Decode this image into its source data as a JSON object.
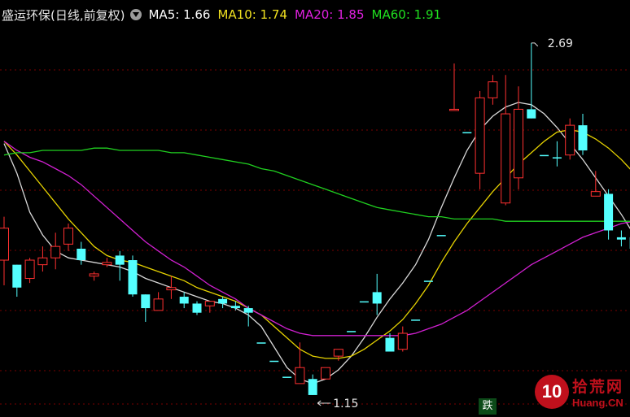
{
  "header": {
    "title": "盛运环保(日线,前复权)",
    "ma": [
      {
        "label": "MA5: ",
        "value": "1.66",
        "color": "#ffffff"
      },
      {
        "label": "MA10: ",
        "value": "1.74",
        "color": "#f0e020"
      },
      {
        "label": "MA20: ",
        "value": "1.85",
        "color": "#e020e0"
      },
      {
        "label": "MA60: ",
        "value": "1.91",
        "color": "#20e020"
      }
    ]
  },
  "annotations": {
    "high_label": "2.69",
    "low_label": "1.15",
    "fall_badge": "跌"
  },
  "watermark": {
    "number": "10",
    "cn": "拾荒网",
    "en": "Huang.CN"
  },
  "colors": {
    "up": "#ff3030",
    "down": "#54ffff",
    "grid": "#7a0000"
  },
  "chart_data": {
    "type": "candlestick",
    "ylim": [
      1.1,
      2.75
    ],
    "candles": [
      [
        1.88,
        1.74,
        1.93,
        1.63,
        "up"
      ],
      [
        1.72,
        1.62,
        1.72,
        1.58,
        "down"
      ],
      [
        1.66,
        1.74,
        1.75,
        1.64,
        "up"
      ],
      [
        1.72,
        1.75,
        1.8,
        1.69,
        "up"
      ],
      [
        1.75,
        1.8,
        1.86,
        1.7,
        "up"
      ],
      [
        1.81,
        1.88,
        1.9,
        1.78,
        "up"
      ],
      [
        1.79,
        1.74,
        1.82,
        1.72,
        "down"
      ],
      [
        1.68,
        1.67,
        1.69,
        1.65,
        "up"
      ],
      [
        1.72,
        1.73,
        1.75,
        1.71,
        "up"
      ],
      [
        1.76,
        1.72,
        1.78,
        1.65,
        "down"
      ],
      [
        1.74,
        1.59,
        1.76,
        1.58,
        "down"
      ],
      [
        1.59,
        1.53,
        1.59,
        1.47,
        "down"
      ],
      [
        1.52,
        1.57,
        1.6,
        1.52,
        "up"
      ],
      [
        1.61,
        1.62,
        1.67,
        1.57,
        "up"
      ],
      [
        1.58,
        1.55,
        1.6,
        1.53,
        "down"
      ],
      [
        1.55,
        1.51,
        1.56,
        1.5,
        "down"
      ],
      [
        1.54,
        1.56,
        1.56,
        1.51,
        "up"
      ],
      [
        1.57,
        1.55,
        1.58,
        1.53,
        "down"
      ],
      [
        1.54,
        1.53,
        1.56,
        1.52,
        "down"
      ],
      [
        1.53,
        1.51,
        1.54,
        1.45,
        "down"
      ],
      [
        1.38,
        1.38,
        1.38,
        1.38,
        "down"
      ],
      [
        1.3,
        1.3,
        1.3,
        1.3,
        "down"
      ],
      [
        1.23,
        1.23,
        1.23,
        1.23,
        "down"
      ],
      [
        1.2,
        1.27,
        1.38,
        1.2,
        "up"
      ],
      [
        1.22,
        1.15,
        1.24,
        1.15,
        "down"
      ],
      [
        1.22,
        1.27,
        1.27,
        1.22,
        "up"
      ],
      [
        1.32,
        1.35,
        1.35,
        1.3,
        "up"
      ],
      [
        1.43,
        1.43,
        1.43,
        1.43,
        "down"
      ],
      [
        1.56,
        1.56,
        1.56,
        1.56,
        "down"
      ],
      [
        1.6,
        1.55,
        1.68,
        1.5,
        "down"
      ],
      [
        1.4,
        1.34,
        1.42,
        1.34,
        "down"
      ],
      [
        1.35,
        1.42,
        1.45,
        1.34,
        "up"
      ],
      [
        1.48,
        1.48,
        1.48,
        1.48,
        "down"
      ],
      [
        1.65,
        1.65,
        1.65,
        1.65,
        "down"
      ],
      [
        1.85,
        1.85,
        1.85,
        1.85,
        "down"
      ],
      [
        2.4,
        2.4,
        2.6,
        2.4,
        "up"
      ],
      [
        2.3,
        2.3,
        2.3,
        2.3,
        "down"
      ],
      [
        2.12,
        2.45,
        2.48,
        2.05,
        "up"
      ],
      [
        2.45,
        2.52,
        2.55,
        2.42,
        "up"
      ],
      [
        1.99,
        2.38,
        2.55,
        1.98,
        "up"
      ],
      [
        2.1,
        2.4,
        2.5,
        2.05,
        "up"
      ],
      [
        2.4,
        2.36,
        2.69,
        2.36,
        "down"
      ],
      [
        2.2,
        2.2,
        2.2,
        2.2,
        "down"
      ],
      [
        2.19,
        2.19,
        2.26,
        2.15,
        "down"
      ],
      [
        2.2,
        2.33,
        2.36,
        2.18,
        "up"
      ],
      [
        2.33,
        2.22,
        2.38,
        2.2,
        "down"
      ],
      [
        2.02,
        2.04,
        2.13,
        2.02,
        "up"
      ],
      [
        2.03,
        1.87,
        2.05,
        1.83,
        "down"
      ],
      [
        1.84,
        1.83,
        1.87,
        1.8,
        "down"
      ],
      [
        1.84,
        1.79,
        1.87,
        1.76,
        "down"
      ]
    ],
    "series": [
      {
        "name": "MA5",
        "color": "#d8d8d8",
        "values": [
          2.25,
          2.12,
          1.95,
          1.85,
          1.78,
          1.75,
          1.74,
          1.73,
          1.72,
          1.71,
          1.69,
          1.66,
          1.64,
          1.62,
          1.6,
          1.58,
          1.56,
          1.55,
          1.53,
          1.5,
          1.45,
          1.36,
          1.27,
          1.22,
          1.2,
          1.22,
          1.26,
          1.32,
          1.4,
          1.49,
          1.57,
          1.64,
          1.72,
          1.83,
          1.97,
          2.1,
          2.22,
          2.31,
          2.37,
          2.41,
          2.43,
          2.42,
          2.38,
          2.32,
          2.25,
          2.18,
          2.1,
          2.02,
          1.94,
          1.85
        ]
      },
      {
        "name": "MA10",
        "color": "#e6d200",
        "values": [
          2.26,
          2.2,
          2.13,
          2.06,
          1.99,
          1.92,
          1.86,
          1.8,
          1.76,
          1.74,
          1.73,
          1.71,
          1.69,
          1.67,
          1.65,
          1.62,
          1.6,
          1.58,
          1.56,
          1.53,
          1.5,
          1.45,
          1.4,
          1.35,
          1.32,
          1.31,
          1.31,
          1.32,
          1.35,
          1.39,
          1.43,
          1.48,
          1.55,
          1.63,
          1.73,
          1.82,
          1.9,
          1.97,
          2.04,
          2.1,
          2.16,
          2.21,
          2.26,
          2.3,
          2.31,
          2.3,
          2.27,
          2.23,
          2.18,
          2.12
        ]
      },
      {
        "name": "MA20",
        "color": "#d020d0",
        "values": [
          2.26,
          2.22,
          2.19,
          2.17,
          2.14,
          2.11,
          2.07,
          2.02,
          1.97,
          1.92,
          1.87,
          1.82,
          1.78,
          1.74,
          1.71,
          1.67,
          1.63,
          1.6,
          1.57,
          1.53,
          1.5,
          1.47,
          1.44,
          1.42,
          1.41,
          1.41,
          1.41,
          1.41,
          1.41,
          1.41,
          1.41,
          1.41,
          1.42,
          1.44,
          1.46,
          1.49,
          1.52,
          1.56,
          1.6,
          1.64,
          1.68,
          1.72,
          1.75,
          1.78,
          1.81,
          1.84,
          1.86,
          1.88,
          1.9,
          1.91
        ]
      },
      {
        "name": "MA60",
        "color": "#20d020",
        "values": [
          2.2,
          2.21,
          2.21,
          2.22,
          2.22,
          2.22,
          2.22,
          2.23,
          2.23,
          2.22,
          2.22,
          2.22,
          2.22,
          2.21,
          2.21,
          2.2,
          2.19,
          2.18,
          2.17,
          2.16,
          2.14,
          2.13,
          2.11,
          2.09,
          2.07,
          2.05,
          2.03,
          2.01,
          1.99,
          1.97,
          1.96,
          1.95,
          1.94,
          1.93,
          1.93,
          1.92,
          1.92,
          1.92,
          1.92,
          1.91,
          1.91,
          1.91,
          1.91,
          1.91,
          1.91,
          1.91,
          1.91,
          1.91,
          1.91,
          1.91
        ]
      }
    ]
  }
}
